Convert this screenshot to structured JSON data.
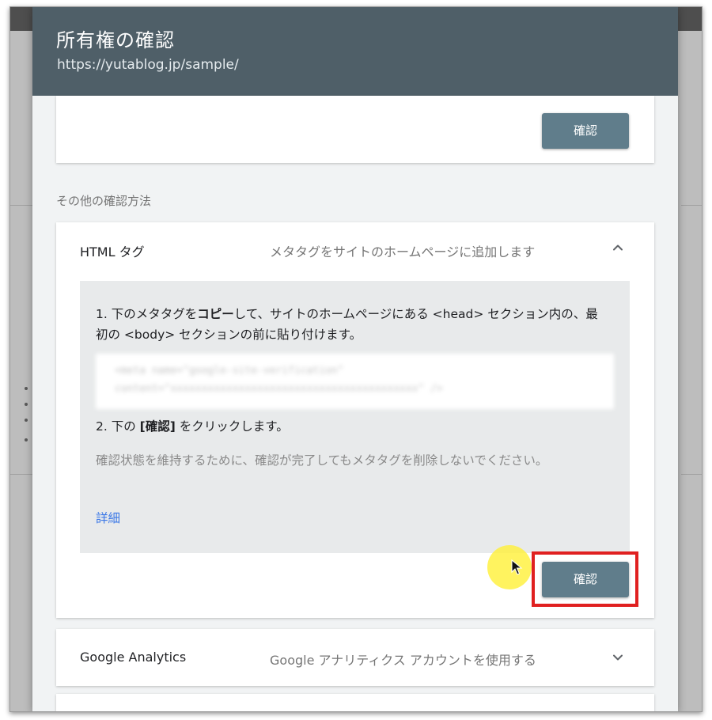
{
  "dialog": {
    "title": "所有権の確認",
    "property_url": "https://yutablog.jp/sample/"
  },
  "top_card": {
    "verify_label": "確認"
  },
  "other_methods": {
    "label": "その他の確認方法"
  },
  "html_tag": {
    "title": "HTML タグ",
    "description": "メタタグをサイトのホームページに追加します",
    "expanded": true,
    "step1": {
      "prefix": "1. 下のメタタグを",
      "bold": "コピー",
      "suffix": "して、サイトのホームページにある <head> セクション内の、最初の <body> セクションの前に貼り付けます。"
    },
    "step2": {
      "prefix": "2. 下の ",
      "bold": "[確認]",
      "suffix": " をクリックします。"
    },
    "note": "確認状態を維持するために、確認が完了してもメタタグを削除しないでください。",
    "more_link": "詳細",
    "verify_label": "確認"
  },
  "google_analytics": {
    "title": "Google Analytics",
    "description": "Google アナリティクス アカウントを使用する",
    "expanded": false
  },
  "colors": {
    "header_bg": "#4f5f68",
    "button_bg": "#607d8b",
    "highlight_border": "#e02020",
    "link": "#3b78e7"
  }
}
